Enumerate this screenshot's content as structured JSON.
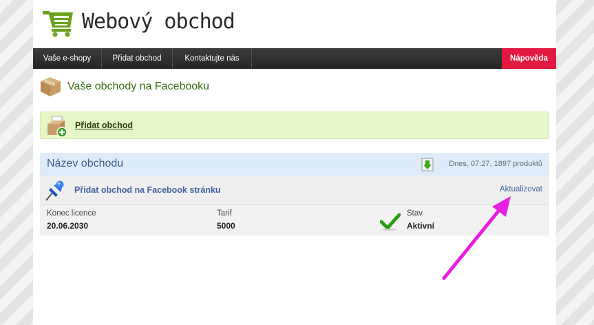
{
  "header": {
    "logo_title": "Webový obchod",
    "logo_icon": "shopping-cart-icon"
  },
  "nav": {
    "items": [
      {
        "label": "Vaše e-shopy"
      },
      {
        "label": "Přidat obchod"
      },
      {
        "label": "Kontaktujte nás"
      }
    ],
    "help_label": "Nápověda"
  },
  "main": {
    "page_title": "Vaše obchody na Facebooku",
    "add_shop_link": "Přidat obchod",
    "shop": {
      "name_header": "Název obchodu",
      "meta": "Dnes, 07:27, 1897 produktů",
      "add_to_page_link": "Přidat obchod na Facebook stránku",
      "update_link": "Aktualizovat",
      "details": {
        "license_label": "Konec licence",
        "license_value": "20.06.2030",
        "tariff_label": "Tarif",
        "tariff_value": "5000",
        "status_label": "Stav",
        "status_value": "Aktivní"
      }
    }
  },
  "colors": {
    "brand_green": "#6aa31f",
    "help_red": "#e2193f",
    "annotation_arrow": "#e81ee0",
    "status_check": "#2a9d12"
  }
}
